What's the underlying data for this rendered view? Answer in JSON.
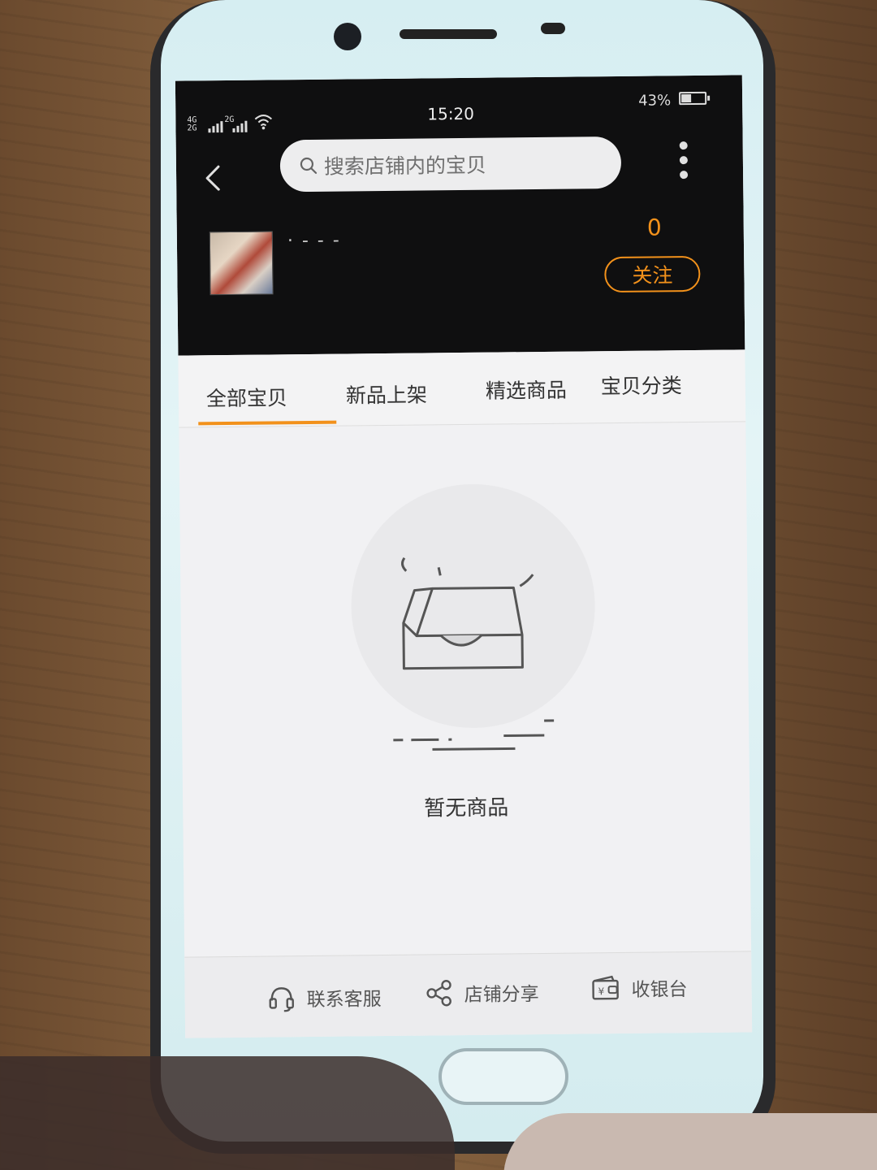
{
  "status_bar": {
    "network_label": "4G\n2G",
    "network_label_2": "2G",
    "time": "15:20",
    "battery_percent": "43%",
    "battery_level": 0.43
  },
  "header": {
    "search_placeholder": "搜索店铺内的宝贝",
    "shop_name": "· - - -",
    "follower_count": "0",
    "follow_label": "关注"
  },
  "tabs": [
    {
      "label": "全部宝贝",
      "active": true
    },
    {
      "label": "新品上架",
      "active": false
    },
    {
      "label": "精选商品",
      "active": false
    },
    {
      "label": "宝贝分类",
      "active": false
    }
  ],
  "empty_state": {
    "message": "暂无商品"
  },
  "bottom_bar": {
    "items": [
      {
        "label": "联系客服",
        "icon": "headset-icon"
      },
      {
        "label": "店铺分享",
        "icon": "share-icon"
      },
      {
        "label": "收银台",
        "icon": "wallet-icon"
      }
    ]
  },
  "colors": {
    "accent": "#f2911b",
    "header_bg": "#0f0f10",
    "page_bg": "#f1f1f3"
  }
}
